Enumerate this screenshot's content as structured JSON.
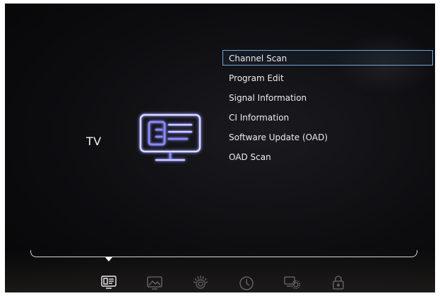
{
  "screen": {
    "section_title": "TV"
  },
  "menu": {
    "items": [
      {
        "label": "Channel Scan",
        "selected": true
      },
      {
        "label": "Program Edit",
        "selected": false
      },
      {
        "label": "Signal Information",
        "selected": false
      },
      {
        "label": "CI Information",
        "selected": false
      },
      {
        "label": "Software Update (OAD)",
        "selected": false
      },
      {
        "label": "OAD Scan",
        "selected": false
      }
    ]
  },
  "tabs": [
    {
      "icon": "tv-menu-icon",
      "active": true
    },
    {
      "icon": "picture-icon",
      "active": false
    },
    {
      "icon": "sound-icon",
      "active": false
    },
    {
      "icon": "clock-icon",
      "active": false
    },
    {
      "icon": "settings-icon",
      "active": false
    },
    {
      "icon": "lock-icon",
      "active": false
    }
  ],
  "colors": {
    "accent_icon": "#7b7bff",
    "selection_border": "#6fa8d8",
    "text": "#ededed"
  }
}
